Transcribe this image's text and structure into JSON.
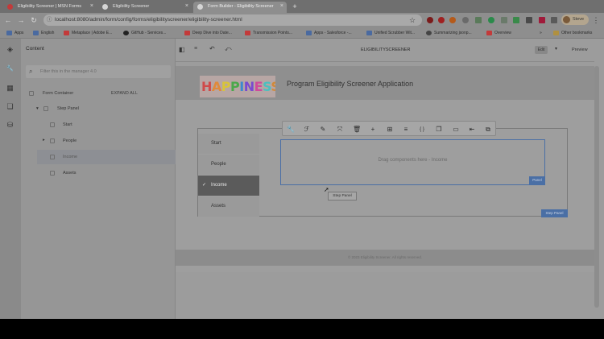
{
  "tabs": [
    {
      "label": "Eligibility Screener | MSN Forms",
      "active": false,
      "color": "#c33a3a"
    },
    {
      "label": "Eligibility Screener",
      "active": false,
      "color": "#e0e0e0"
    },
    {
      "label": "Form Builder - Eligibility Screener",
      "active": true,
      "color": "#e0e0e0"
    }
  ],
  "new_tab_glyph": "+",
  "url": "localhost:8080/admin/form/config/forms/eligibilityscreener/eligibility-screener.html",
  "profile": "Steve",
  "bookmarks": [
    {
      "label": "Apps",
      "color": "#4a6aa0"
    },
    {
      "label": "English",
      "color": "#4a6aa0"
    },
    {
      "label": "Metaplace | Adobe E...",
      "color": "#c33a3a"
    },
    {
      "label": "GitHub - Services...",
      "color": "#222222"
    },
    {
      "label": "Deep Dive into Date...",
      "color": "#c33a3a"
    },
    {
      "label": "Transmission Points...",
      "color": "#c33a3a"
    },
    {
      "label": "Apps - Salesforce -...",
      "color": "#4a6aa0"
    },
    {
      "label": "Unified Scrubber Wit...",
      "color": "#4a6aa0"
    },
    {
      "label": "Summarizing jsonp...",
      "color": "#444444"
    },
    {
      "label": "Overview",
      "color": "#c33a3a"
    }
  ],
  "bookmarks_more": "»",
  "other_bookmarks": "Other bookmarks",
  "editor": {
    "panel_title": "Content",
    "filter_placeholder": "Filter this in the manager 4.0",
    "doc_title": "ELIGIBILITYSCREENER",
    "edit_label": "Edit",
    "preview_label": "Preview"
  },
  "tree": {
    "root": "Form Container",
    "expand_all": "EXPAND ALL",
    "step_panel": "Step Panel",
    "items": [
      "Start",
      "People",
      "Income",
      "Assets"
    ]
  },
  "form": {
    "logo_text": "HAPPINESS",
    "logo_colors": [
      "#d04a4a",
      "#e08a3a",
      "#d8c43a",
      "#4aa84a",
      "#3a8ad0",
      "#7a4ad0",
      "#d04a9a",
      "#4ac0c0",
      "#d08a3a"
    ],
    "title": "Program Eligibility Screener Application",
    "steps": [
      "Start",
      "People",
      "Income",
      "Assets"
    ],
    "active_step": 2,
    "drop_text": "Drag components here - Income",
    "panel_badge": "Panel",
    "step_panel_badge": "Step Panel",
    "tooltip": "Step Panel",
    "footer": "© 2023 Eligibility Screener. All rights reserved.",
    "check_glyph": "✓"
  },
  "toolbar_icons": [
    {
      "name": "wrench-icon",
      "glyph": "🔧"
    },
    {
      "name": "style-icon",
      "glyph": "ℱ"
    },
    {
      "name": "paint-icon",
      "glyph": "✎"
    },
    {
      "name": "select-parent-icon",
      "glyph": "⤧"
    },
    {
      "name": "delete-icon",
      "glyph": "🗑"
    },
    {
      "name": "add-icon",
      "glyph": "+"
    },
    {
      "name": "layout-icon",
      "glyph": "⊞"
    },
    {
      "name": "list-icon",
      "glyph": "≡"
    },
    {
      "name": "braces-icon",
      "glyph": "{ }"
    },
    {
      "name": "copy-icon",
      "glyph": "❐"
    },
    {
      "name": "panel-icon",
      "glyph": "▭"
    },
    {
      "name": "arrow-in-icon",
      "glyph": "⇤"
    },
    {
      "name": "more-icon",
      "glyph": "⧉"
    }
  ],
  "icons": {
    "back": "←",
    "forward": "→",
    "reload": "↻",
    "star": "☆",
    "menu": "⋮",
    "search": "⌕",
    "layers": "◈",
    "tools": "🔧",
    "grid": "▦",
    "pages": "❏",
    "db": "⛁",
    "chevron_down": "▾",
    "chevron_right": "▸",
    "undo": "↶",
    "redo": "⤺",
    "sidebar": "◧"
  }
}
